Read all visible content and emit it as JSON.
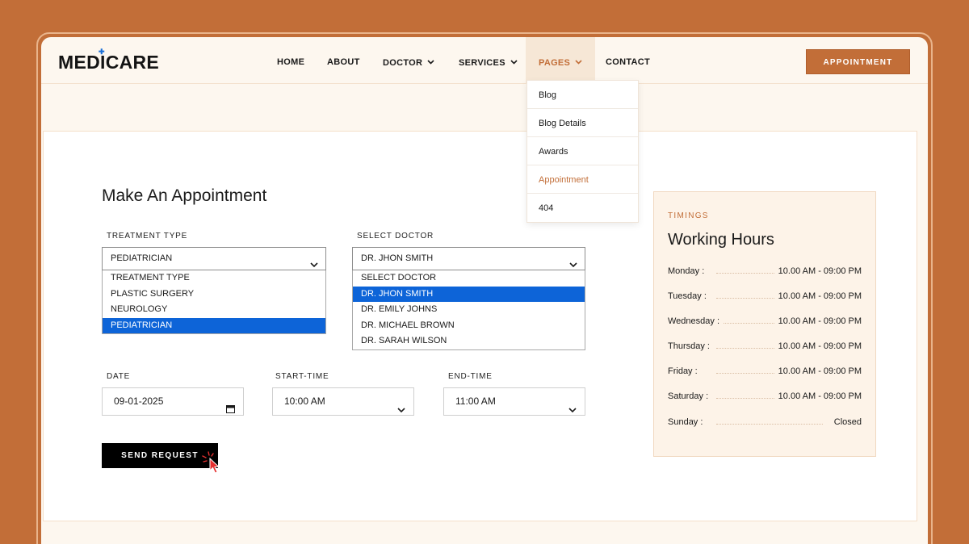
{
  "brand": {
    "name": "MEDICARE"
  },
  "nav": {
    "items": [
      {
        "label": "HOME",
        "has_dropdown": false
      },
      {
        "label": "ABOUT",
        "has_dropdown": false
      },
      {
        "label": "DOCTOR",
        "has_dropdown": true
      },
      {
        "label": "SERVICES",
        "has_dropdown": true
      },
      {
        "label": "PAGES",
        "has_dropdown": true,
        "active": true
      },
      {
        "label": "CONTACT",
        "has_dropdown": false
      }
    ],
    "cta_label": "APPOINTMENT"
  },
  "pages_menu": {
    "items": [
      "Blog",
      "Blog Details",
      "Awards",
      "Appointment",
      "404"
    ],
    "active": "Appointment"
  },
  "form": {
    "title": "Make An Appointment",
    "treatment": {
      "label": "TREATMENT TYPE",
      "value": "PEDIATRICIAN",
      "options": [
        "TREATMENT TYPE",
        "PLASTIC SURGERY",
        "NEUROLOGY",
        "PEDIATRICIAN"
      ]
    },
    "doctor": {
      "label": "SELECT DOCTOR",
      "value": "DR. JHON SMITH",
      "options": [
        "SELECT DOCTOR",
        "DR. JHON SMITH",
        "DR. EMILY JOHNS",
        "DR. MICHAEL BROWN",
        "DR. SARAH WILSON"
      ]
    },
    "date": {
      "label": "DATE",
      "value": "09-01-2025"
    },
    "start_time": {
      "label": "START-TIME",
      "value": "10:00 AM"
    },
    "end_time": {
      "label": "END-TIME",
      "value": "11:00 AM"
    },
    "submit_label": "SEND REQUEST"
  },
  "timings": {
    "eyebrow": "TIMINGS",
    "title": "Working Hours",
    "rows": [
      {
        "day": "Monday :",
        "hours": "10.00 AM - 09:00 PM"
      },
      {
        "day": "Tuesday :",
        "hours": "10.00 AM - 09:00 PM"
      },
      {
        "day": "Wednesday :",
        "hours": "10.00 AM - 09:00 PM"
      },
      {
        "day": "Thursday :",
        "hours": "10.00 AM - 09:00 PM"
      },
      {
        "day": "Friday :",
        "hours": "10.00 AM - 09:00 PM"
      },
      {
        "day": "Saturday :",
        "hours": "10.00 AM - 09:00 PM"
      },
      {
        "day": "Sunday :",
        "hours": "Closed"
      }
    ]
  },
  "colors": {
    "brand": "#c26e38",
    "selection": "#0d64d8",
    "logo_cross": "#1a6fd8",
    "cursor": "#e53030"
  }
}
